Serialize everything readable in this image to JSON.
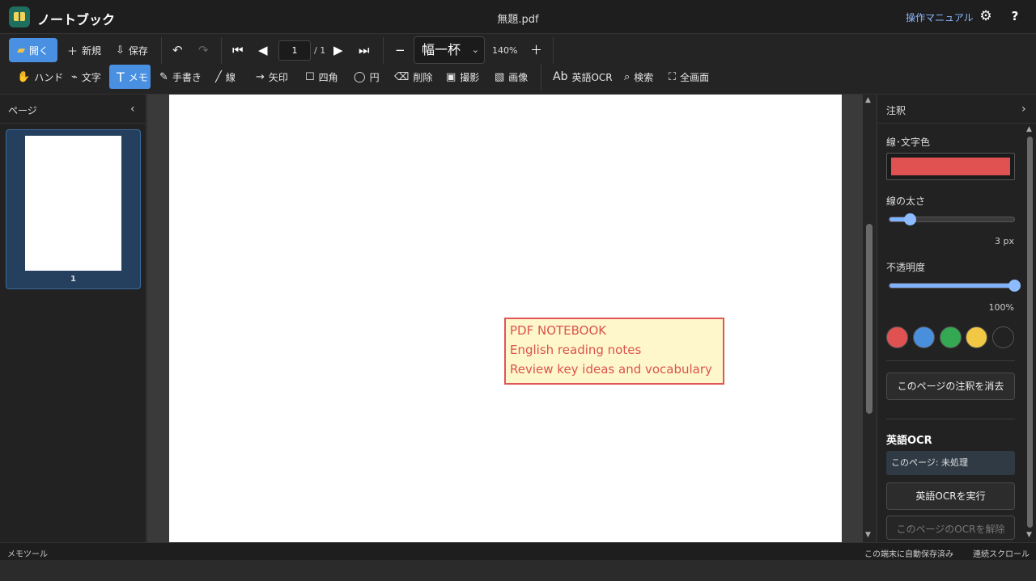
{
  "app": {
    "name": "ノートブック",
    "file_name": "無題.pdf",
    "manual_link": "操作マニュアル",
    "settings_icon": "gear-icon",
    "help_label": "?"
  },
  "toolbar": {
    "open_label": "開く",
    "new_label": "新規",
    "save_label": "保存",
    "page_current": "1",
    "page_total": "/ 1",
    "zoom_mode": "幅一杯",
    "zoom_value": "140%",
    "tools": {
      "hand": "ハンド",
      "text": "文字",
      "memo": "メモ",
      "handwrite": "手書き",
      "line": "線",
      "arrow": "矢印",
      "rect": "四角",
      "circle": "円",
      "delete": "削除",
      "capture": "撮影",
      "image": "画像",
      "ocr": "英語OCR",
      "search": "検索",
      "fullscreen": "全画面"
    }
  },
  "left_panel": {
    "title": "ページ",
    "pages": [
      {
        "number": "1"
      }
    ]
  },
  "document": {
    "note_lines": [
      "PDF NOTEBOOK",
      "English reading notes",
      "Review key ideas and vocabulary"
    ]
  },
  "right_panel": {
    "title": "注釈",
    "color_label": "線･文字色",
    "color_value": "#e05252",
    "thickness_label": "線の太さ",
    "thickness_value": "3 px",
    "thickness_level": 0.16,
    "opacity_label": "不透明度",
    "opacity_value": "100%",
    "opacity_level": 1.0,
    "swatches": [
      "#e05252",
      "#4a8fdc",
      "#34a853",
      "#f2c744",
      "#222222"
    ],
    "clear_button": "このページの注釈を消去",
    "ocr_heading": "英語OCR",
    "ocr_status": "このページ: 未処理",
    "ocr_run_button": "英語OCRを実行",
    "ocr_clear_button": "このページのOCRを解除"
  },
  "status": {
    "mode": "メモツール",
    "autosave": "この端末に自動保存済み",
    "scroll_mode": "連続スクロール"
  }
}
